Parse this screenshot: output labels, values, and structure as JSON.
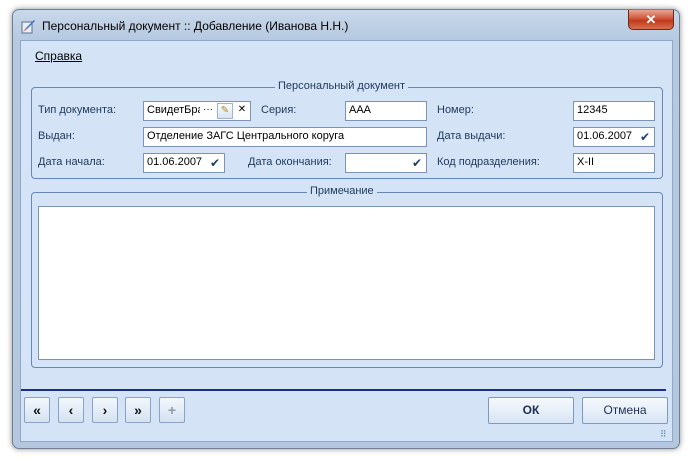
{
  "window": {
    "title": "Персональный документ :: Добавление  (Иванова Н.Н.)",
    "close_glyph": "✕"
  },
  "menu": {
    "help_label": "Справка"
  },
  "document_group": {
    "legend": "Персональный документ",
    "doc_type_label": "Тип документа:",
    "doc_type_value": "СвидетБрак",
    "series_label": "Серия:",
    "series_value": "ААА",
    "number_label": "Номер:",
    "number_value": "12345",
    "issued_by_label": "Выдан:",
    "issued_by_value": "Отделение ЗАГС Центрального коруга",
    "issue_date_label": "Дата выдачи:",
    "issue_date_value": "01.06.2007",
    "start_date_label": "Дата начала:",
    "start_date_value": "01.06.2007",
    "end_date_label": "Дата окончания:",
    "end_date_value": "",
    "dept_code_label": "Код подразделения:",
    "dept_code_value": "X-II"
  },
  "note_group": {
    "legend": "Примечание",
    "value": ""
  },
  "nav": {
    "first": "«",
    "prev": "‹",
    "next": "›",
    "last": "»",
    "add": "+"
  },
  "buttons": {
    "ok": "ОК",
    "cancel": "Отмена"
  },
  "icons": {
    "ellipsis": "···",
    "edit": "✎",
    "clear": "✕",
    "check": "✔",
    "grip": "⠿"
  }
}
